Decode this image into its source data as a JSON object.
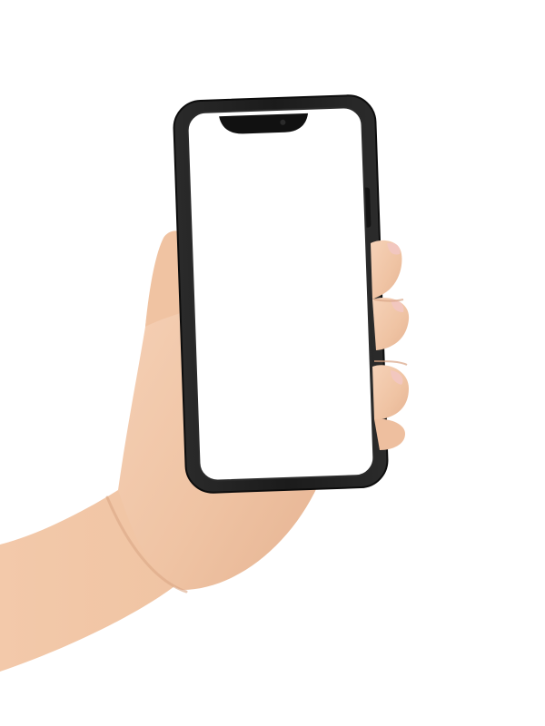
{
  "scene": {
    "subject": "hand-holding-phone",
    "colors": {
      "background": "#ffffff",
      "skin": "#f1c6a6",
      "skin_shadow": "#e0ad8c",
      "skin_highlight": "#f7d6bd",
      "nail": "#f2c7bf",
      "phone_case": "#1f1f1f",
      "phone_case_edge": "#0f0f0f",
      "screen": "#ffffff",
      "notch": "#111111"
    }
  }
}
